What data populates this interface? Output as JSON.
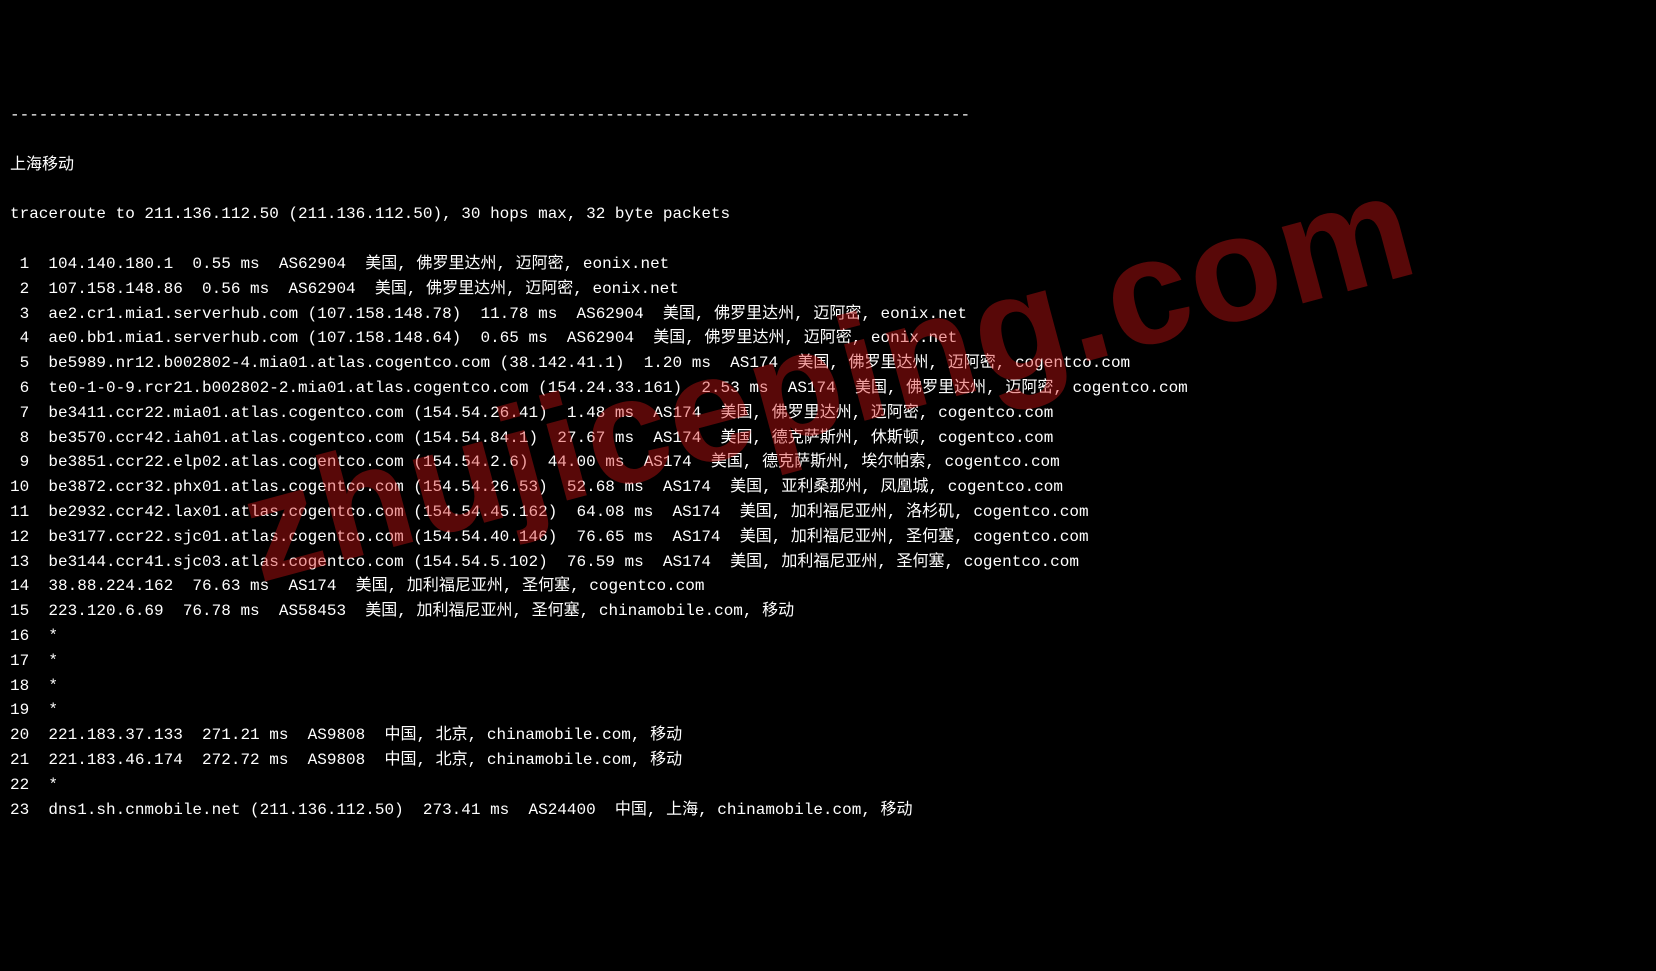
{
  "divider": "----------------------------------------------------------------------------------------------------",
  "header_label": "上海移动",
  "trace_header": "traceroute to 211.136.112.50 (211.136.112.50), 30 hops max, 32 byte packets",
  "hops": [
    " 1  104.140.180.1  0.55 ms  AS62904  美国, 佛罗里达州, 迈阿密, eonix.net",
    " 2  107.158.148.86  0.56 ms  AS62904  美国, 佛罗里达州, 迈阿密, eonix.net",
    " 3  ae2.cr1.mia1.serverhub.com (107.158.148.78)  11.78 ms  AS62904  美国, 佛罗里达州, 迈阿密, eonix.net",
    " 4  ae0.bb1.mia1.serverhub.com (107.158.148.64)  0.65 ms  AS62904  美国, 佛罗里达州, 迈阿密, eonix.net",
    " 5  be5989.nr12.b002802-4.mia01.atlas.cogentco.com (38.142.41.1)  1.20 ms  AS174  美国, 佛罗里达州, 迈阿密, cogentco.com",
    " 6  te0-1-0-9.rcr21.b002802-2.mia01.atlas.cogentco.com (154.24.33.161)  2.53 ms  AS174  美国, 佛罗里达州, 迈阿密, cogentco.com",
    " 7  be3411.ccr22.mia01.atlas.cogentco.com (154.54.26.41)  1.48 ms  AS174  美国, 佛罗里达州, 迈阿密, cogentco.com",
    " 8  be3570.ccr42.iah01.atlas.cogentco.com (154.54.84.1)  27.67 ms  AS174  美国, 德克萨斯州, 休斯顿, cogentco.com",
    " 9  be3851.ccr22.elp02.atlas.cogentco.com (154.54.2.6)  44.00 ms  AS174  美国, 德克萨斯州, 埃尔帕索, cogentco.com",
    "10  be3872.ccr32.phx01.atlas.cogentco.com (154.54.26.53)  52.68 ms  AS174  美国, 亚利桑那州, 凤凰城, cogentco.com",
    "11  be2932.ccr42.lax01.atlas.cogentco.com (154.54.45.162)  64.08 ms  AS174  美国, 加利福尼亚州, 洛杉矶, cogentco.com",
    "12  be3177.ccr22.sjc01.atlas.cogentco.com (154.54.40.146)  76.65 ms  AS174  美国, 加利福尼亚州, 圣何塞, cogentco.com",
    "13  be3144.ccr41.sjc03.atlas.cogentco.com (154.54.5.102)  76.59 ms  AS174  美国, 加利福尼亚州, 圣何塞, cogentco.com",
    "14  38.88.224.162  76.63 ms  AS174  美国, 加利福尼亚州, 圣何塞, cogentco.com",
    "15  223.120.6.69  76.78 ms  AS58453  美国, 加利福尼亚州, 圣何塞, chinamobile.com, 移动",
    "16  *",
    "17  *",
    "18  *",
    "19  *",
    "20  221.183.37.133  271.21 ms  AS9808  中国, 北京, chinamobile.com, 移动",
    "21  221.183.46.174  272.72 ms  AS9808  中国, 北京, chinamobile.com, 移动",
    "22  *",
    "23  dns1.sh.cnmobile.net (211.136.112.50)  273.41 ms  AS24400  中国, 上海, chinamobile.com, 移动"
  ],
  "watermark": "zhujiceping.com"
}
